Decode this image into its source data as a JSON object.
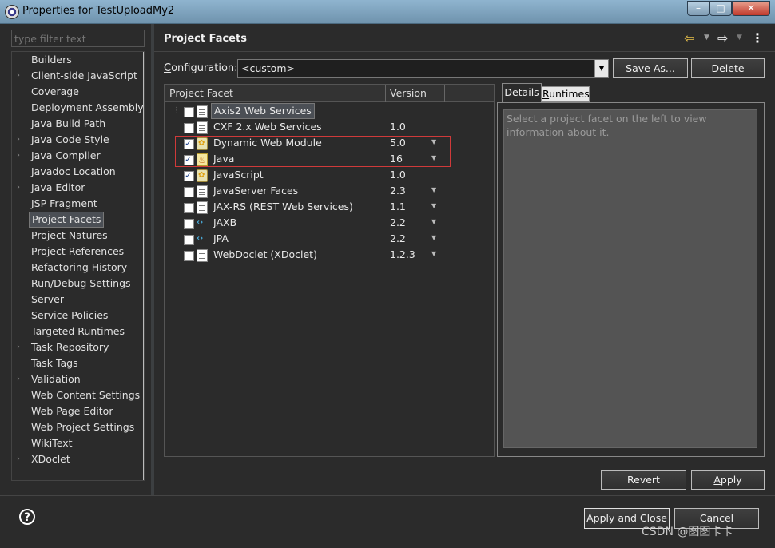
{
  "window": {
    "title": "Properties for TestUploadMy2",
    "minimize": "–",
    "maximize": "□",
    "close": "✕"
  },
  "filter": {
    "placeholder": "type filter text"
  },
  "tree": [
    {
      "label": "Builders",
      "expandable": false
    },
    {
      "label": "Client-side JavaScript",
      "expandable": true
    },
    {
      "label": "Coverage",
      "expandable": false
    },
    {
      "label": "Deployment Assembly",
      "expandable": false
    },
    {
      "label": "Java Build Path",
      "expandable": false
    },
    {
      "label": "Java Code Style",
      "expandable": true
    },
    {
      "label": "Java Compiler",
      "expandable": true
    },
    {
      "label": "Javadoc Location",
      "expandable": false
    },
    {
      "label": "Java Editor",
      "expandable": true
    },
    {
      "label": "JSP Fragment",
      "expandable": false
    },
    {
      "label": "Project Facets",
      "expandable": false,
      "selected": true
    },
    {
      "label": "Project Natures",
      "expandable": false
    },
    {
      "label": "Project References",
      "expandable": false
    },
    {
      "label": "Refactoring History",
      "expandable": false
    },
    {
      "label": "Run/Debug Settings",
      "expandable": false
    },
    {
      "label": "Server",
      "expandable": false
    },
    {
      "label": "Service Policies",
      "expandable": false
    },
    {
      "label": "Targeted Runtimes",
      "expandable": false
    },
    {
      "label": "Task Repository",
      "expandable": true
    },
    {
      "label": "Task Tags",
      "expandable": false
    },
    {
      "label": "Validation",
      "expandable": true
    },
    {
      "label": "Web Content Settings",
      "expandable": false
    },
    {
      "label": "Web Page Editor",
      "expandable": false
    },
    {
      "label": "Web Project Settings",
      "expandable": false
    },
    {
      "label": "WikiText",
      "expandable": false
    },
    {
      "label": "XDoclet",
      "expandable": true
    }
  ],
  "page": {
    "title": "Project Facets"
  },
  "configuration": {
    "label": "Configuration:",
    "value": "<custom>",
    "save_as": "Save As...",
    "delete": "Delete"
  },
  "facets_table": {
    "col_facet": "Project Facet",
    "col_version": "Version",
    "rows": [
      {
        "name": "Axis2 Web Services",
        "version": "",
        "checked": false,
        "icon": "folder",
        "has_dropdown": false,
        "highlighted": true,
        "tree_line": true
      },
      {
        "name": "CXF 2.x Web Services",
        "version": "1.0",
        "checked": false,
        "icon": "doc",
        "has_dropdown": false
      },
      {
        "name": "Dynamic Web Module",
        "version": "5.0",
        "checked": true,
        "icon": "gear-doc",
        "has_dropdown": true
      },
      {
        "name": "Java",
        "version": "16",
        "checked": true,
        "icon": "java",
        "has_dropdown": true
      },
      {
        "name": "JavaScript",
        "version": "1.0",
        "checked": true,
        "icon": "gear-doc",
        "has_dropdown": false
      },
      {
        "name": "JavaServer Faces",
        "version": "2.3",
        "checked": false,
        "icon": "doc",
        "has_dropdown": true
      },
      {
        "name": "JAX-RS (REST Web Services)",
        "version": "1.1",
        "checked": false,
        "icon": "doc",
        "has_dropdown": true
      },
      {
        "name": "JAXB",
        "version": "2.2",
        "checked": false,
        "icon": "code",
        "has_dropdown": true
      },
      {
        "name": "JPA",
        "version": "2.2",
        "checked": false,
        "icon": "code",
        "has_dropdown": true
      },
      {
        "name": "WebDoclet (XDoclet)",
        "version": "1.2.3",
        "checked": false,
        "icon": "doc",
        "has_dropdown": true
      }
    ]
  },
  "details": {
    "tab_details": "Details",
    "tab_runtimes": "Runtimes",
    "text": "Select a project facet on the left to view information about it."
  },
  "buttons": {
    "revert": "Revert",
    "apply": "Apply",
    "apply_close": "Apply and Close",
    "cancel": "Cancel"
  },
  "watermark": "CSDN @图图卡卡",
  "colors": {
    "selection_outline": "#d03a3a",
    "background": "#2b2b2b"
  }
}
